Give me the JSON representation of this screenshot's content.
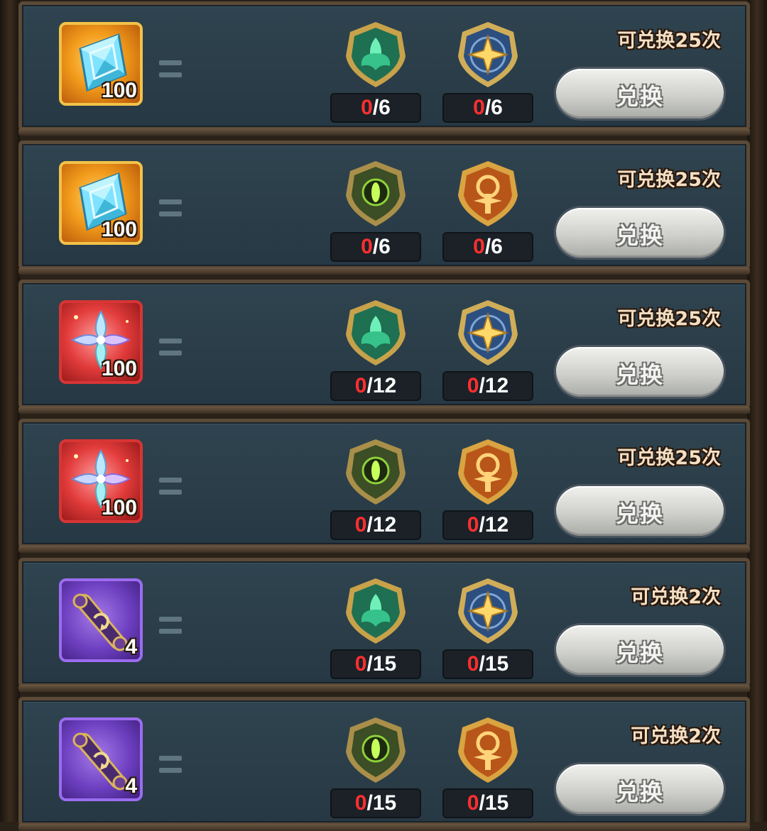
{
  "exchange_list": [
    {
      "reward": {
        "icon": "crystal-diamond-icon",
        "rarity_color": "#f2c24a",
        "quantity": "100"
      },
      "costs": [
        {
          "icon": "green-leaf-emblem-icon",
          "have": "0",
          "need": "/6"
        },
        {
          "icon": "blue-star-emblem-icon",
          "have": "0",
          "need": "/6"
        }
      ],
      "limit_text": "可兑换25次",
      "button_label": "兑换"
    },
    {
      "reward": {
        "icon": "crystal-diamond-icon",
        "rarity_color": "#f2c24a",
        "quantity": "100"
      },
      "costs": [
        {
          "icon": "green-eye-emblem-icon",
          "have": "0",
          "need": "/6"
        },
        {
          "icon": "orange-sun-emblem-icon",
          "have": "0",
          "need": "/6"
        }
      ],
      "limit_text": "可兑换25次",
      "button_label": "兑换"
    },
    {
      "reward": {
        "icon": "rainbow-crystal-flower-icon",
        "rarity_color": "#d83535",
        "quantity": "100"
      },
      "costs": [
        {
          "icon": "green-leaf-emblem-icon",
          "have": "0",
          "need": "/12"
        },
        {
          "icon": "blue-star-emblem-icon",
          "have": "0",
          "need": "/12"
        }
      ],
      "limit_text": "可兑换25次",
      "button_label": "兑换"
    },
    {
      "reward": {
        "icon": "rainbow-crystal-flower-icon",
        "rarity_color": "#d83535",
        "quantity": "100"
      },
      "costs": [
        {
          "icon": "green-eye-emblem-icon",
          "have": "0",
          "need": "/12"
        },
        {
          "icon": "orange-sun-emblem-icon",
          "have": "0",
          "need": "/12"
        }
      ],
      "limit_text": "可兑换25次",
      "button_label": "兑换"
    },
    {
      "reward": {
        "icon": "purple-scroll-icon",
        "rarity_color": "#9b6cf0",
        "quantity": "4"
      },
      "costs": [
        {
          "icon": "green-leaf-emblem-icon",
          "have": "0",
          "need": "/15"
        },
        {
          "icon": "blue-star-emblem-icon",
          "have": "0",
          "need": "/15"
        }
      ],
      "limit_text": "可兑换2次",
      "button_label": "兑换"
    },
    {
      "reward": {
        "icon": "purple-scroll-icon",
        "rarity_color": "#9b6cf0",
        "quantity": "4"
      },
      "costs": [
        {
          "icon": "green-eye-emblem-icon",
          "have": "0",
          "need": "/15"
        },
        {
          "icon": "orange-sun-emblem-icon",
          "have": "0",
          "need": "/15"
        }
      ],
      "limit_text": "可兑换2次",
      "button_label": "兑换"
    }
  ]
}
